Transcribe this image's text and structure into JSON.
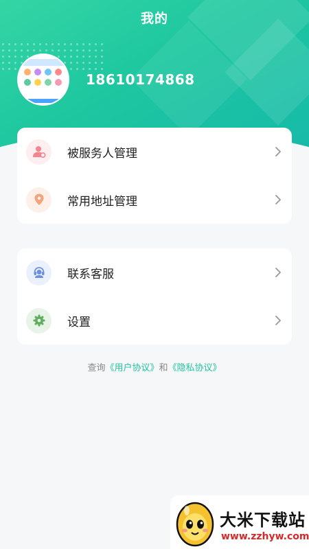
{
  "header": {
    "title": "我的",
    "phone": "18610174868"
  },
  "menu_group_1": [
    {
      "label": "被服务人管理",
      "icon": "person-gear-icon",
      "icon_color": "#f0868f",
      "icon_bg": "#fdeef0"
    },
    {
      "label": "常用地址管理",
      "icon": "map-pin-icon",
      "icon_color": "#f6a27b",
      "icon_bg": "#fdf0e8"
    }
  ],
  "menu_group_2": [
    {
      "label": "联系客服",
      "icon": "headset-icon",
      "icon_color": "#6d8fe0",
      "icon_bg": "#eaf0fc"
    },
    {
      "label": "设置",
      "icon": "gear-icon",
      "icon_color": "#5fae5e",
      "icon_bg": "#e8f4e8"
    }
  ],
  "footer": {
    "prefix": "查询",
    "user_agreement": "《用户协议》",
    "connector": "和",
    "privacy_policy": "《隐私协议》"
  },
  "colors": {
    "accent": "#1ec7a0",
    "chevron": "#999999"
  },
  "watermark": {
    "title": "大米下载站",
    "url": "www.zzhyw.com"
  }
}
